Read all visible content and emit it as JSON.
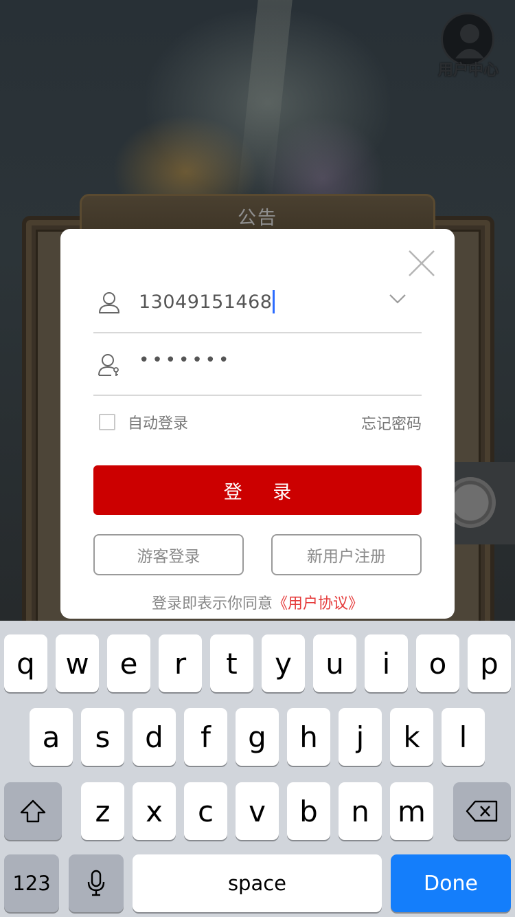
{
  "background": {
    "user_center_label": "用户中心",
    "notice_title": "公告"
  },
  "login": {
    "account_value": "13049151468",
    "password_mask": "•••••••",
    "auto_login_label": "自动登录",
    "auto_login_checked": false,
    "forgot_password": "忘记密码",
    "login_button": "登 录",
    "guest_login_button": "游客登录",
    "register_button": "新用户注册",
    "agreement_prefix": "登录即表示你同意",
    "agreement_link": "《用户协议》",
    "accent_color": "#cc0000",
    "link_color": "#e53b3b"
  },
  "keyboard": {
    "row1": [
      "q",
      "w",
      "e",
      "r",
      "t",
      "y",
      "u",
      "i",
      "o",
      "p"
    ],
    "row2": [
      "a",
      "s",
      "d",
      "f",
      "g",
      "h",
      "j",
      "k",
      "l"
    ],
    "row3": [
      "z",
      "x",
      "c",
      "v",
      "b",
      "n",
      "m"
    ],
    "numbers_key": "123",
    "space_key": "space",
    "done_key": "Done",
    "done_color": "#147efb"
  }
}
